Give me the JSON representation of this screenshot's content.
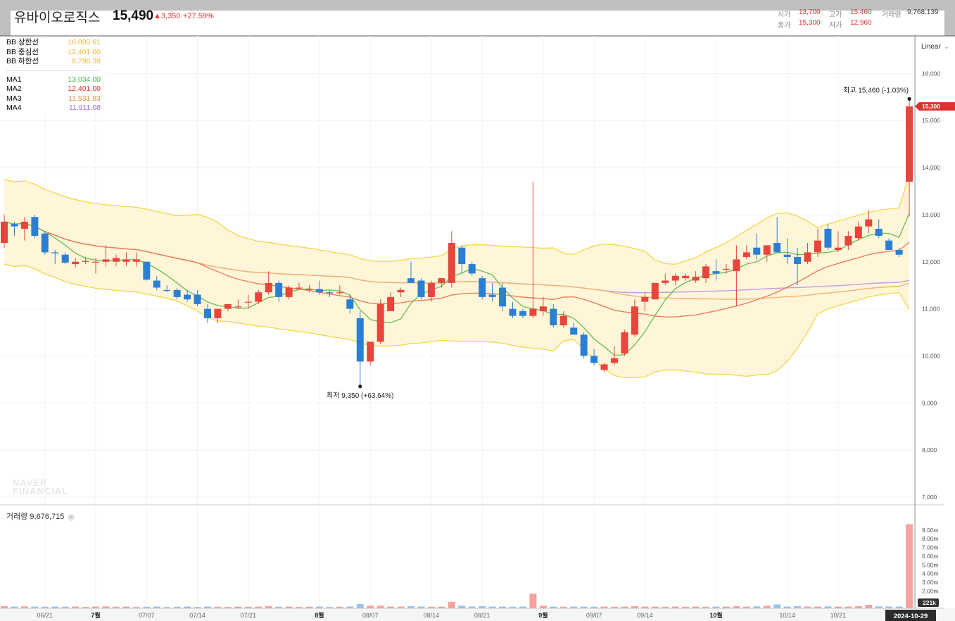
{
  "header": {
    "stock_name": "유바이오로직스",
    "price": "15,490",
    "change": "▲3,350",
    "change_pct": "+27.59%",
    "open_label": "시가",
    "open": "13,700",
    "high_label": "고가",
    "high": "15,460",
    "volume_label": "거래량",
    "volume": "9,768,139",
    "close_label": "종가",
    "close": "15,300",
    "low_label": "저가",
    "low": "12,960"
  },
  "legend": {
    "bb_upper_label": "BB 상한선",
    "bb_upper": "16,005.61",
    "bb_mid_label": "BB 중심선",
    "bb_mid": "12,401.00",
    "bb_lower_label": "BB 하한선",
    "bb_lower": "8,796.39",
    "ma1_label": "MA1",
    "ma1": "13,034.00",
    "ma2_label": "MA2",
    "ma2": "12,401.00",
    "ma3_label": "MA3",
    "ma3": "11,531.83",
    "ma4_label": "MA4",
    "ma4": "11,911.08"
  },
  "scale_mode": "Linear",
  "volume_panel": {
    "title": "거래량 9,676,715",
    "close_icon": "close-icon"
  },
  "watermark": "NAVER FINANCIAL",
  "colors": {
    "up": "#e8453c",
    "down": "#2a7fd4",
    "bb_line": "#f5d547",
    "bb_fill": "#fff6d9",
    "ma1": "#6fbf5b",
    "ma2": "#ef7d5a",
    "ma3": "#f3b46e",
    "ma4": "#c39be0",
    "accent": "#e03131"
  },
  "chart_data": {
    "type": "candlestick",
    "y_axis": {
      "ticks": [
        7000,
        8000,
        9000,
        10000,
        11000,
        12000,
        13000,
        14000,
        15000,
        16000
      ],
      "tick_labels": [
        "7,000",
        "8,000",
        "9,000",
        "10,000",
        "11,000",
        "12,000",
        "13,000",
        "14,000",
        "15,000",
        "16,000"
      ],
      "range": [
        6900,
        16500
      ]
    },
    "x_axis": {
      "tick_labels": [
        "06/21",
        "7월",
        "07/07",
        "07/14",
        "07/21",
        "8월",
        "08/07",
        "08/14",
        "08/21",
        "9월",
        "09/07",
        "09/14",
        "10월",
        "10/14",
        "10/21"
      ],
      "tick_indices": [
        4,
        9,
        14,
        19,
        24,
        31,
        36,
        42,
        47,
        53,
        58,
        63,
        70,
        77,
        82
      ],
      "current_label": "2024-10-29"
    },
    "candles": [
      [
        12400,
        13000,
        12300,
        12850
      ],
      [
        12800,
        12850,
        12550,
        12750
      ],
      [
        12700,
        12950,
        12450,
        12850
      ],
      [
        12950,
        13000,
        12500,
        12550
      ],
      [
        12600,
        12650,
        12150,
        12200
      ],
      [
        12200,
        12250,
        11950,
        12180
      ],
      [
        12150,
        12200,
        11950,
        11980
      ],
      [
        11950,
        12080,
        11880,
        12000
      ],
      [
        12000,
        12100,
        11950,
        12020
      ],
      [
        12000,
        12080,
        11750,
        12000
      ],
      [
        12000,
        12350,
        11900,
        12050
      ],
      [
        12000,
        12150,
        11900,
        12080
      ],
      [
        12000,
        12200,
        11900,
        12050
      ],
      [
        12000,
        12200,
        11900,
        12050
      ],
      [
        12000,
        12000,
        11600,
        11620
      ],
      [
        11600,
        11700,
        11400,
        11450
      ],
      [
        11400,
        11500,
        11350,
        11380
      ],
      [
        11400,
        11450,
        11200,
        11250
      ],
      [
        11300,
        11400,
        11150,
        11200
      ],
      [
        11300,
        11400,
        11050,
        11100
      ],
      [
        11000,
        11100,
        10700,
        10800
      ],
      [
        10800,
        11000,
        10700,
        11000
      ],
      [
        11000,
        11100,
        10950,
        11100
      ],
      [
        11050,
        11200,
        11000,
        11050
      ],
      [
        11150,
        11300,
        11000,
        11150
      ],
      [
        11150,
        11400,
        11100,
        11350
      ],
      [
        11350,
        11800,
        11300,
        11550
      ],
      [
        11550,
        11600,
        11150,
        11250
      ],
      [
        11250,
        11500,
        11200,
        11450
      ],
      [
        11450,
        11550,
        11400,
        11450
      ],
      [
        11400,
        11500,
        11350,
        11420
      ],
      [
        11420,
        11600,
        11300,
        11350
      ],
      [
        11350,
        11400,
        11250,
        11330
      ],
      [
        11350,
        11500,
        11300,
        11350
      ],
      [
        11200,
        11300,
        10900,
        11000
      ],
      [
        10800,
        10950,
        9350,
        9880
      ],
      [
        9880,
        10200,
        9800,
        10300
      ],
      [
        10300,
        11200,
        10250,
        11100
      ],
      [
        10950,
        11350,
        10950,
        11250
      ],
      [
        11350,
        11450,
        11250,
        11400
      ],
      [
        11650,
        12000,
        11550,
        11550
      ],
      [
        11600,
        11650,
        11200,
        11250
      ],
      [
        11250,
        11600,
        11150,
        11550
      ],
      [
        11550,
        11650,
        11450,
        11650
      ],
      [
        11550,
        12650,
        11450,
        12400
      ],
      [
        12300,
        12350,
        11750,
        11950
      ],
      [
        11950,
        12000,
        11700,
        11750
      ],
      [
        11650,
        11700,
        11200,
        11250
      ],
      [
        11300,
        11550,
        11150,
        11250
      ],
      [
        11450,
        11550,
        10950,
        11050
      ],
      [
        11000,
        11150,
        10800,
        10850
      ],
      [
        10950,
        11000,
        10800,
        10850
      ],
      [
        10850,
        13700,
        10800,
        11000
      ],
      [
        10950,
        11250,
        10850,
        11050
      ],
      [
        11000,
        11100,
        10600,
        10650
      ],
      [
        10650,
        10950,
        10600,
        10850
      ],
      [
        10600,
        10700,
        10450,
        10450
      ],
      [
        10450,
        10500,
        9950,
        10000
      ],
      [
        10000,
        10150,
        9800,
        9850
      ],
      [
        9700,
        9850,
        9650,
        9820
      ],
      [
        9850,
        10200,
        9800,
        9950
      ],
      [
        10050,
        10550,
        10000,
        10500
      ],
      [
        10450,
        11200,
        10400,
        11050
      ],
      [
        11150,
        11350,
        10950,
        11250
      ],
      [
        11200,
        11550,
        11200,
        11550
      ],
      [
        11550,
        11750,
        11500,
        11600
      ],
      [
        11600,
        11750,
        11500,
        11700
      ],
      [
        11650,
        11750,
        11600,
        11700
      ],
      [
        11600,
        11800,
        11550,
        11680
      ],
      [
        11650,
        11950,
        11550,
        11900
      ],
      [
        11800,
        12050,
        11600,
        11750
      ],
      [
        11850,
        11950,
        11750,
        11850
      ],
      [
        11800,
        12350,
        11050,
        12050
      ],
      [
        12100,
        12350,
        12050,
        12200
      ],
      [
        12300,
        12600,
        12050,
        12150
      ],
      [
        12150,
        12300,
        12000,
        12350
      ],
      [
        12400,
        12950,
        12300,
        12200
      ],
      [
        12150,
        12500,
        11950,
        12100
      ],
      [
        12100,
        12300,
        11500,
        11950
      ],
      [
        12000,
        12400,
        11950,
        12200
      ],
      [
        12200,
        12700,
        12100,
        12450
      ],
      [
        12700,
        12800,
        12250,
        12300
      ],
      [
        12250,
        12650,
        12200,
        12300
      ],
      [
        12350,
        12650,
        12250,
        12550
      ],
      [
        12500,
        12850,
        12450,
        12750
      ],
      [
        12750,
        13100,
        12600,
        12900
      ],
      [
        12700,
        12900,
        12500,
        12550
      ],
      [
        12450,
        12500,
        12250,
        12250
      ],
      [
        12250,
        12300,
        12100,
        12150
      ],
      [
        13700,
        15460,
        12960,
        15300
      ]
    ],
    "volumes": [
      0.25,
      0.2,
      0.22,
      0.2,
      0.18,
      0.2,
      0.18,
      0.2,
      0.15,
      0.2,
      0.22,
      0.18,
      0.2,
      0.15,
      0.18,
      0.2,
      0.15,
      0.18,
      0.2,
      0.15,
      0.2,
      0.18,
      0.15,
      0.2,
      0.18,
      0.2,
      0.25,
      0.18,
      0.2,
      0.15,
      0.18,
      0.2,
      0.15,
      0.18,
      0.2,
      0.5,
      0.3,
      0.3,
      0.2,
      0.2,
      0.25,
      0.2,
      0.18,
      0.2,
      0.75,
      0.3,
      0.2,
      0.25,
      0.2,
      0.2,
      0.18,
      0.2,
      1.7,
      0.3,
      0.2,
      0.18,
      0.2,
      0.2,
      0.18,
      0.2,
      0.18,
      0.2,
      0.25,
      0.2,
      0.2,
      0.18,
      0.2,
      0.18,
      0.2,
      0.18,
      0.2,
      0.2,
      0.25,
      0.2,
      0.22,
      0.3,
      0.45,
      0.2,
      0.25,
      0.2,
      0.2,
      0.22,
      0.2,
      0.2,
      0.25,
      0.4,
      0.22,
      0.2,
      0.2,
      9.68
    ],
    "volume_ticks": [
      2,
      3,
      4,
      5,
      6,
      7,
      8,
      9
    ],
    "volume_tick_labels": [
      "2.00m",
      "3.00m",
      "4.00m",
      "5.00m",
      "6.00m",
      "7.00m",
      "8.00m",
      "9.00m"
    ],
    "volume_badge": "221k",
    "price_badge": "15,300",
    "high_annotation": "최고 15,460 (-1.03%)",
    "low_annotation": "최저 9,350 (+63.64%)",
    "low_index": 35,
    "high_index": 89
  }
}
